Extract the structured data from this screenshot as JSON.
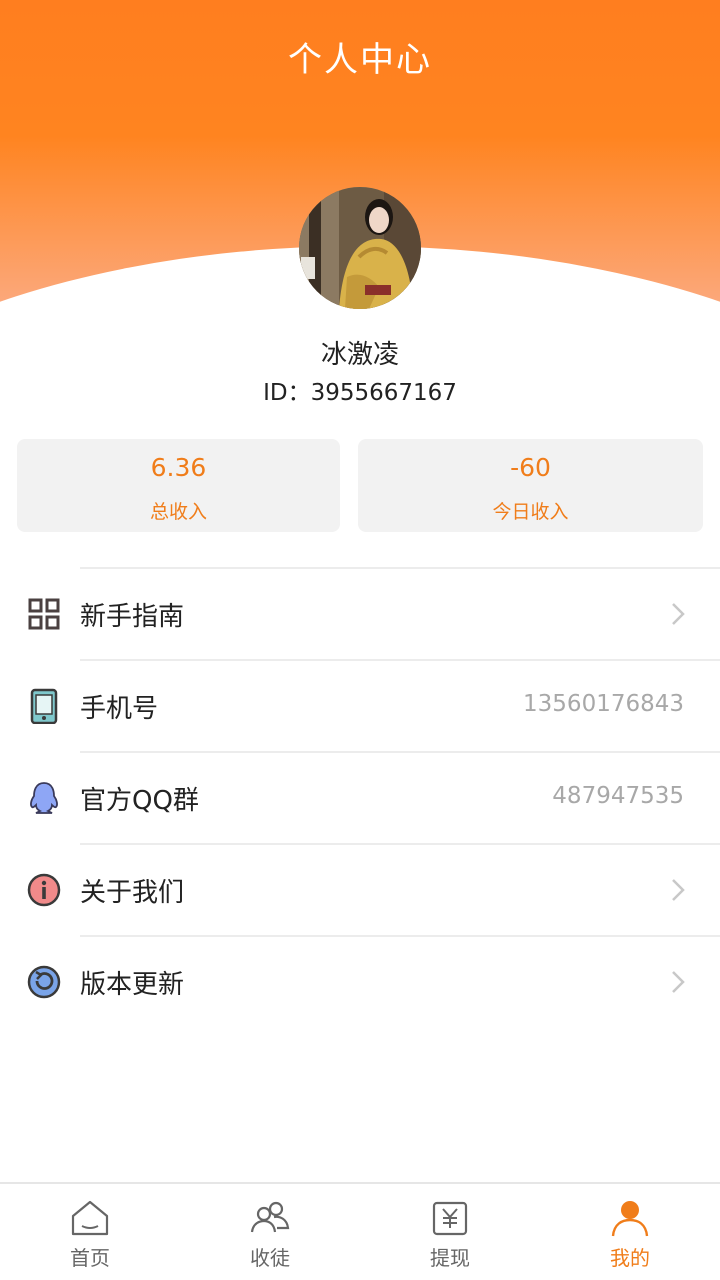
{
  "header": {
    "title": "个人中心"
  },
  "user": {
    "name": "冰激凌",
    "id_text": "ID：3955667167"
  },
  "stats": [
    {
      "value": "6.36",
      "label": "总收入"
    },
    {
      "value": "-60",
      "label": "今日收入"
    }
  ],
  "menu": {
    "items": [
      {
        "label": "新手指南",
        "value": "",
        "icon": "grid-icon",
        "has_chevron": true
      },
      {
        "label": "手机号",
        "value": "13560176843",
        "icon": "phone-icon",
        "has_chevron": false
      },
      {
        "label": "官方QQ群",
        "value": "487947535",
        "icon": "qq-icon",
        "has_chevron": false
      },
      {
        "label": "关于我们",
        "value": "",
        "icon": "info-icon",
        "has_chevron": true
      },
      {
        "label": "版本更新",
        "value": "",
        "icon": "refresh-icon",
        "has_chevron": true
      }
    ]
  },
  "tabbar": {
    "items": [
      {
        "label": "首页",
        "icon": "home-icon",
        "active": false
      },
      {
        "label": "收徒",
        "icon": "users-icon",
        "active": false
      },
      {
        "label": "提现",
        "icon": "yuan-icon",
        "active": false
      },
      {
        "label": "我的",
        "icon": "person-icon",
        "active": true
      }
    ]
  },
  "colors": {
    "accent": "#f07d1a",
    "header_top": "#ff7e1f",
    "header_bottom": "#fbb08f",
    "card_bg": "#f2f2f2",
    "muted_text": "#a8a8a8"
  }
}
